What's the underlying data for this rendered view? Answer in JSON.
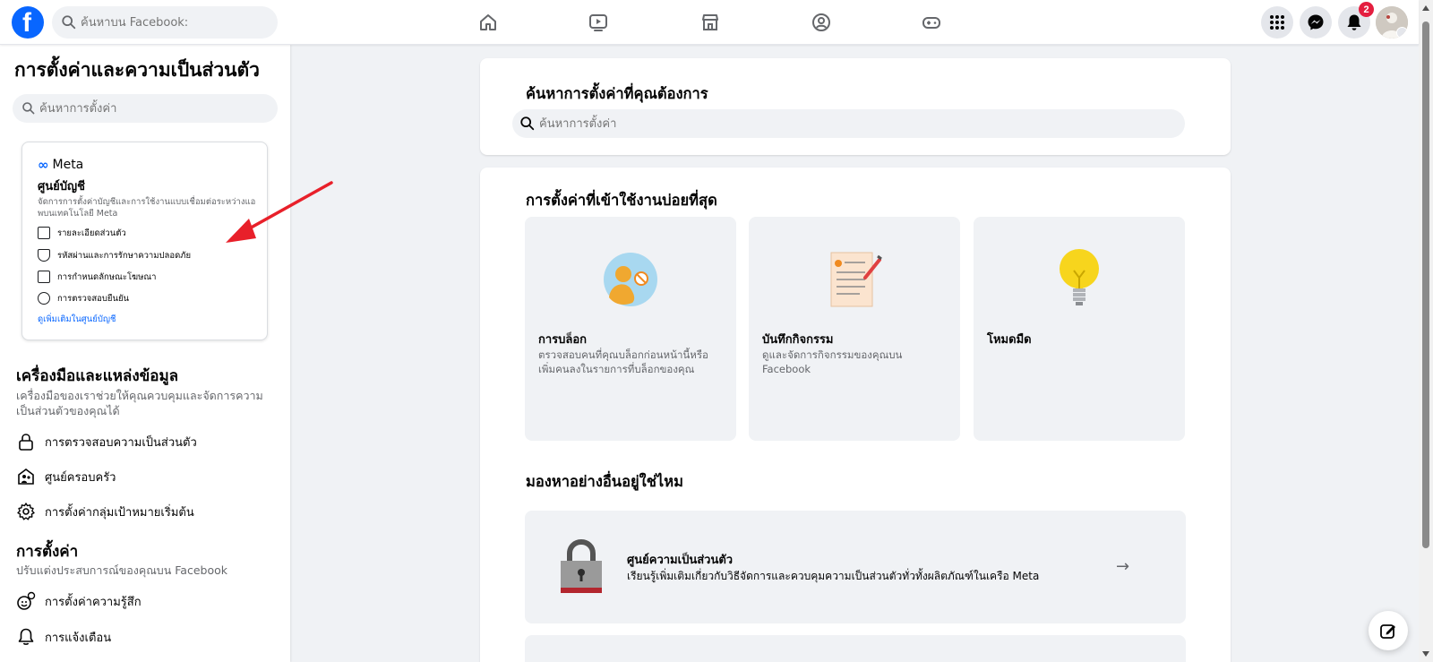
{
  "topbar": {
    "logo_letter": "f",
    "search_placeholder": "ค้นหาบน Facebook:",
    "nav": [
      "home-icon",
      "video-icon",
      "marketplace-icon",
      "groups-icon",
      "gaming-icon"
    ],
    "notifications_count": "2"
  },
  "sidebar": {
    "title": "การตั้งค่าและความเป็นส่วนตัว",
    "search_placeholder": "ค้นหาการตั้งค่า",
    "meta_card": {
      "brand": "Meta",
      "title": "ศูนย์บัญชี",
      "description": "จัดการการตั้งค่าบัญชีและการใช้งานแบบเชื่อมต่อระหว่างแอพบนเทคโนโลยี Meta",
      "items": [
        {
          "label": "รายละเอียดส่วนตัว",
          "icon": "id-card-icon"
        },
        {
          "label": "รหัสผ่านและการรักษาความปลอดภัย",
          "icon": "shield-icon"
        },
        {
          "label": "การกำหนดลักษณะโฆษณา",
          "icon": "monitor-icon"
        },
        {
          "label": "การตรวจสอบยืนยัน",
          "icon": "check-badge-icon"
        }
      ],
      "link": "ดูเพิ่มเติมในศูนย์บัญชี"
    },
    "tools": {
      "title": "เครื่องมือและแหล่งข้อมูล",
      "description": "เครื่องมือของเราช่วยให้คุณควบคุมและจัดการความเป็นส่วนตัวของคุณได้",
      "items": [
        {
          "label": "การตรวจสอบความเป็นส่วนตัว",
          "icon": "lock-icon"
        },
        {
          "label": "ศูนย์ครอบครัว",
          "icon": "family-icon"
        },
        {
          "label": "การตั้งค่ากลุ่มเป้าหมายเริ่มต้น",
          "icon": "gear-icon"
        }
      ]
    },
    "settings": {
      "title": "การตั้งค่า",
      "description": "ปรับแต่งประสบการณ์ของคุณบน Facebook",
      "items": [
        {
          "label": "การตั้งค่าความรู้สึก",
          "icon": "reaction-icon"
        },
        {
          "label": "การแจ้งเตือน",
          "icon": "bell-icon"
        }
      ]
    }
  },
  "main": {
    "search_card": {
      "title": "ค้นหาการตั้งค่าที่คุณต้องการ",
      "placeholder": "ค้นหาการตั้งค่า"
    },
    "frequent": {
      "title": "การตั้งค่าที่เข้าใช้งานบ่อยที่สุด",
      "tiles": [
        {
          "title": "การบล็อก",
          "description": "ตรวจสอบคนที่คุณบล็อกก่อนหน้านี้หรือเพิ่มคนลงในรายการที่บล็อกของคุณ",
          "icon": "blocked-user-icon"
        },
        {
          "title": "บันทึกกิจกรรม",
          "description": "ดูและจัดการกิจกรรมของคุณบน Facebook",
          "icon": "activity-log-icon"
        },
        {
          "title": "โหมดมืด",
          "description": "",
          "icon": "lightbulb-icon"
        }
      ]
    },
    "more": {
      "title": "มองหาอย่างอื่นอยู่ใช่ไหม",
      "items": [
        {
          "title": "ศูนย์ความเป็นส่วนตัว",
          "description": "เรียนรู้เพิ่มเติมเกี่ยวกับวิธีจัดการและควบคุมความเป็นส่วนตัวทั่วทั้งผลิตภัณฑ์ในเครือ Meta",
          "icon": "padlock-icon",
          "arrow": "→"
        }
      ]
    }
  },
  "colors": {
    "brand": "#0866ff",
    "badge": "#e41e3f",
    "background": "#f0f2f5"
  }
}
